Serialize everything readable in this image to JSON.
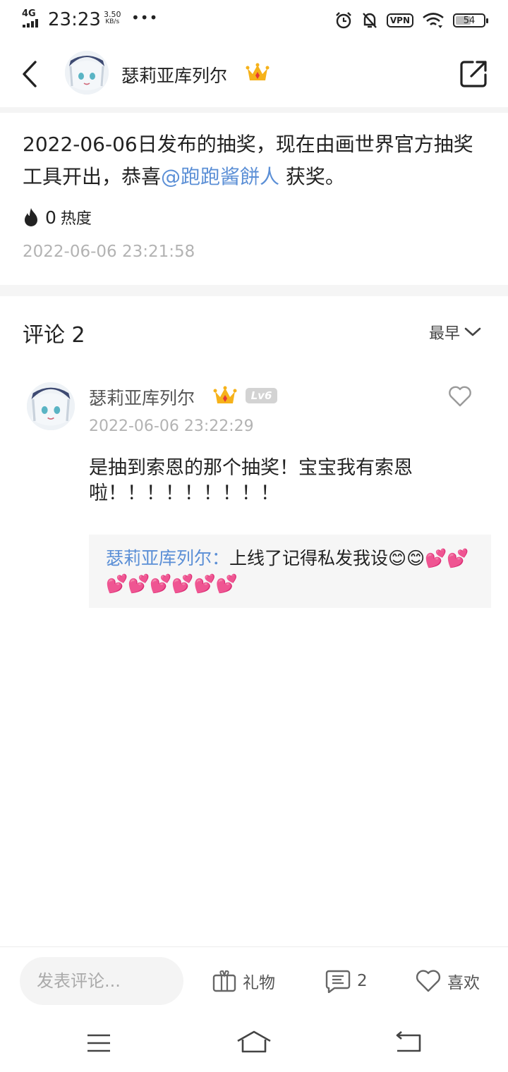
{
  "status_bar": {
    "network": "4G",
    "time": "23:23",
    "speed_value": "3.50",
    "speed_unit": "KB/s",
    "more": "•••",
    "vpn": "VPN",
    "battery": "54",
    "battery_level": 0.54
  },
  "header": {
    "username": "瑟莉亚库列尔",
    "crown_icon": "crown-icon",
    "back_icon": "chevron-left-icon",
    "share_icon": "share-icon"
  },
  "post": {
    "text_before": "2022-06-06日发布的抽奖，现在由画世界官方抽奖工具开出，恭喜",
    "mention": "@跑跑酱餅人",
    "text_after": " 获奖。",
    "heat_count": "0",
    "heat_label": "热度",
    "timestamp": "2022-06-06 23:21:58"
  },
  "comments": {
    "title": "评论 2",
    "sort_label": "最早",
    "items": [
      {
        "username": "瑟莉亚库列尔",
        "level": "Lv6",
        "timestamp": "2022-06-06 23:22:29",
        "text": "是抽到索恩的那个抽奖！宝宝我有索恩啦！！！！！！！！！",
        "reply": {
          "author": "瑟莉亚库列尔：",
          "text": "上线了记得私发我设😊😊💕💕💕💕💕💕💕💕"
        }
      }
    ]
  },
  "bottom_bar": {
    "input_placeholder": "发表评论...",
    "gift_label": "礼物",
    "comment_count": "2",
    "like_label": "喜欢"
  },
  "colors": {
    "accent": "#5b8fd6",
    "muted": "#b3b3b3",
    "section_bg": "#f5f5f5"
  }
}
